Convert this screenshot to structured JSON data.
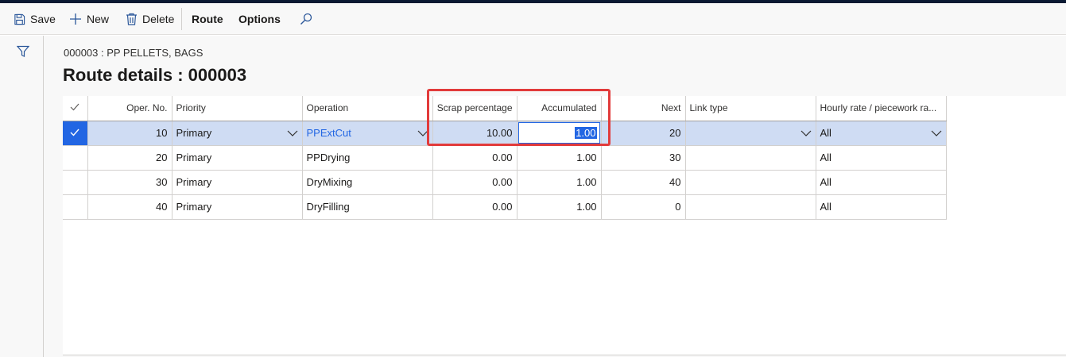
{
  "toolbar": {
    "save_label": "Save",
    "new_label": "New",
    "delete_label": "Delete",
    "route_label": "Route",
    "options_label": "Options"
  },
  "page": {
    "caption": "000003 : PP PELLETS, BAGS",
    "title": "Route details : 000003"
  },
  "grid": {
    "columns": {
      "oper_no": "Oper. No.",
      "priority": "Priority",
      "operation": "Operation",
      "scrap": "Scrap percentage",
      "accumulated": "Accumulated",
      "next": "Next",
      "link_type": "Link type",
      "hourly_rate": "Hourly rate / piecework ra..."
    },
    "rows": [
      {
        "oper_no": "10",
        "priority": "Primary",
        "operation": "PPExtCut",
        "scrap": "10.00",
        "accumulated": "1.00",
        "next": "20",
        "link_type": "",
        "hourly_rate": "All"
      },
      {
        "oper_no": "20",
        "priority": "Primary",
        "operation": "PPDrying",
        "scrap": "0.00",
        "accumulated": "1.00",
        "next": "30",
        "link_type": "",
        "hourly_rate": "All"
      },
      {
        "oper_no": "30",
        "priority": "Primary",
        "operation": "DryMixing",
        "scrap": "0.00",
        "accumulated": "1.00",
        "next": "40",
        "link_type": "",
        "hourly_rate": "All"
      },
      {
        "oper_no": "40",
        "priority": "Primary",
        "operation": "DryFilling",
        "scrap": "0.00",
        "accumulated": "1.00",
        "next": "0",
        "link_type": "",
        "hourly_rate": "All"
      }
    ]
  },
  "colors": {
    "accent": "#2266e3",
    "selected_row": "#cfdcf3",
    "highlight": "#e23b3b"
  },
  "icons": [
    "save-icon",
    "plus-icon",
    "trash-icon",
    "search-icon",
    "filter-icon",
    "checkmark-icon",
    "chevron-down-icon"
  ]
}
